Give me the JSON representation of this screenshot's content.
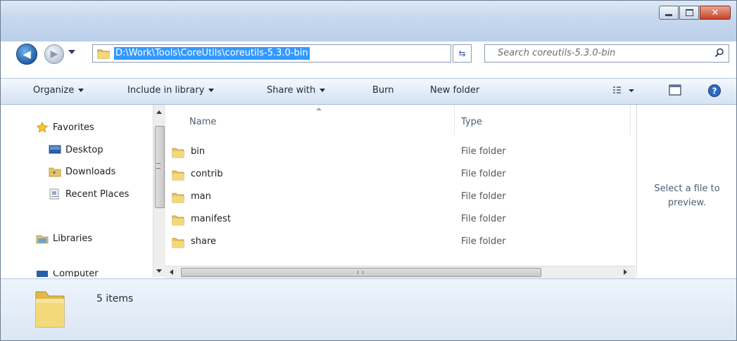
{
  "window": {
    "address_path": "D:\\Work\\Tools\\CoreUtils\\coreutils-5.3.0-bin",
    "search_placeholder": "Search coreutils-5.3.0-bin"
  },
  "toolbar": {
    "organize": "Organize",
    "include_library": "Include in library",
    "share_with": "Share with",
    "burn": "Burn",
    "new_folder": "New folder"
  },
  "navpane": {
    "favorites": "Favorites",
    "desktop": "Desktop",
    "downloads": "Downloads",
    "recent_places": "Recent Places",
    "libraries": "Libraries",
    "computer": "Computer"
  },
  "columns": {
    "name": "Name",
    "type": "Type"
  },
  "files": [
    {
      "name": "bin",
      "type": "File folder"
    },
    {
      "name": "contrib",
      "type": "File folder"
    },
    {
      "name": "man",
      "type": "File folder"
    },
    {
      "name": "manifest",
      "type": "File folder"
    },
    {
      "name": "share",
      "type": "File folder"
    }
  ],
  "preview": {
    "text": "Select a file to preview."
  },
  "details": {
    "count": "5 items"
  },
  "icons": {
    "back": "back-arrow-icon",
    "forward": "forward-arrow-icon",
    "folder": "folder-icon",
    "refresh": "refresh-icon",
    "search": "search-icon",
    "star": "star-icon",
    "views": "views-icon",
    "preview_pane": "preview-pane-icon",
    "help": "help-icon"
  },
  "colors": {
    "accent": "#3399ff",
    "titlebar": "#c6d8ee",
    "close": "#c7452a"
  }
}
